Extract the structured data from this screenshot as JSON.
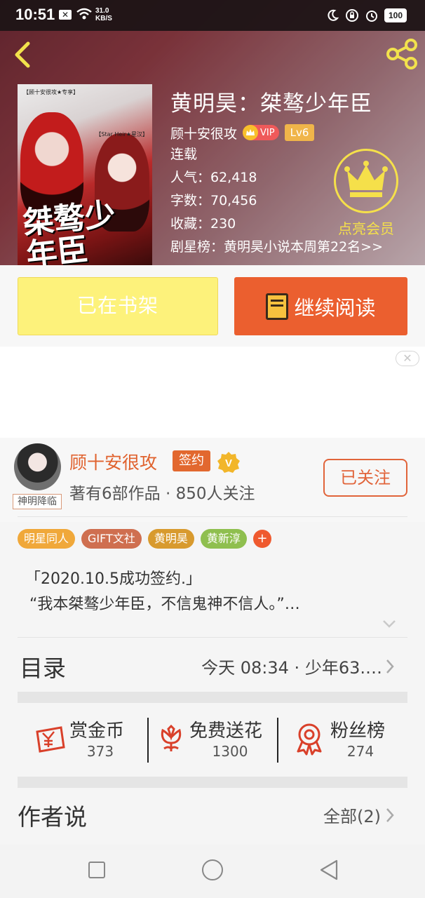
{
  "status_bar": {
    "time": "10:51",
    "speed_value": "31.0",
    "speed_unit": "KB/S",
    "battery": "100"
  },
  "book": {
    "title": "黄明昊：桀骜少年臣",
    "author": "顾十安很攻",
    "vip": "VIP",
    "level": "Lv6",
    "status": "连载",
    "popularity": "人气：62,418",
    "word_count": "字数：70,456",
    "collections": "收藏：230",
    "rank": "剧星榜：黄明昊小说本周第22名>>",
    "cover_title": "桀骜少年臣",
    "cover_sub": "【顾十安很攻★专享】",
    "cover_sub2": "【Star Heir★星汉】"
  },
  "member": {
    "label": "点亮会员",
    "accent": "#f5e04a"
  },
  "actions": {
    "shelf_label": "已在书架",
    "read_label": "继续阅读"
  },
  "ad": {
    "close_label": "✕"
  },
  "author": {
    "name": "顾十安很攻",
    "avatar_tag": "神明降临",
    "sign_badge": "签约",
    "v_badge": "V",
    "stats": "著有6部作品 · 850人关注",
    "follow_label": "已关注"
  },
  "tags": [
    {
      "label": "明星同人",
      "color": "#f0a83a"
    },
    {
      "label": "GIFT文社",
      "color": "#cf6f50"
    },
    {
      "label": "黄明昊",
      "color": "#d89a2e"
    },
    {
      "label": "黄新淳",
      "color": "#8fbf4f"
    }
  ],
  "tag_more": "+",
  "description": {
    "line1": "「2020.10.5成功签约.」",
    "line2": "“我本桀骜少年臣，不信鬼神不信人。”…"
  },
  "toc": {
    "label": "目录",
    "update": "今天 08:34 · 少年63.…"
  },
  "gifts": [
    {
      "title": "赏金币",
      "value": "373"
    },
    {
      "title": "免费送花",
      "value": "1300"
    },
    {
      "title": "粉丝榜",
      "value": "274"
    }
  ],
  "author_says": {
    "label": "作者说",
    "all": "全部(2)"
  },
  "colors": {
    "accent_orange": "#eb5f2f",
    "shelf_yellow": "#fdf27b",
    "icon_red": "#d9402a"
  }
}
